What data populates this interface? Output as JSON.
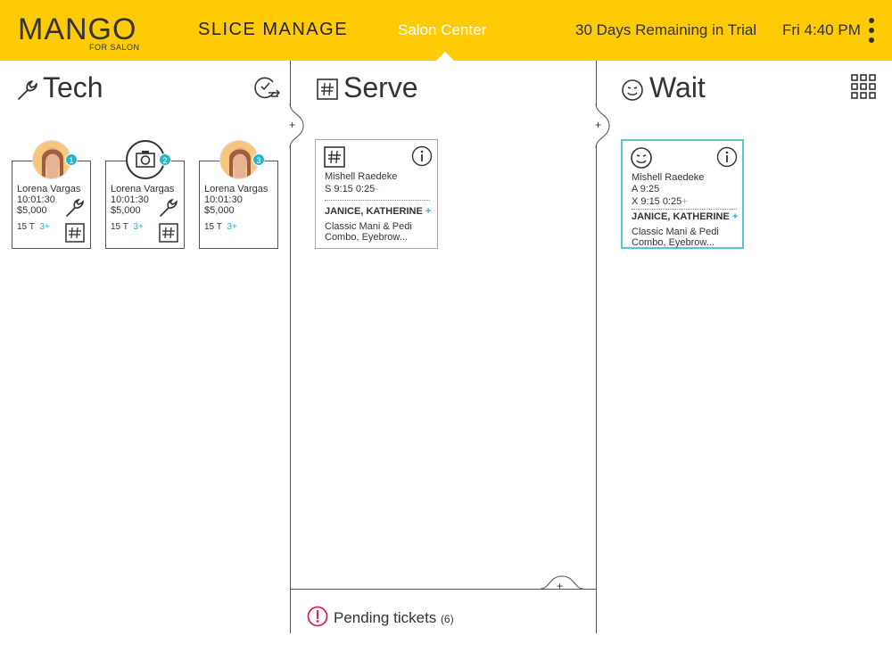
{
  "header": {
    "logo_text": "MANGO",
    "logo_sub": "FOR SALON",
    "nav_slice": "SLICE MANAGE",
    "nav_salon": "Salon Center",
    "trial": "30 Days Remaining in Trial",
    "clock": "Fri 4:40 PM",
    "brand_color": "#FFCB05",
    "accent_color": "#27B5C8"
  },
  "tech": {
    "title": "Tech",
    "cards": [
      {
        "badge": "1",
        "name": "Lorena Vargas",
        "time": "10:01:30",
        "money": "$5,000",
        "count": "15 T",
        "plus": "3+"
      },
      {
        "badge": "2",
        "name": "Lorena Vargas",
        "time": "10:01:30",
        "money": "$5,000",
        "count": "15 T",
        "plus": "3+"
      },
      {
        "badge": "3",
        "name": "Lorena Vargas",
        "time": "10:01:30",
        "money": "$5,000",
        "count": "15 T",
        "plus": "3+"
      }
    ]
  },
  "serve": {
    "title": "Serve",
    "plus": "+",
    "ticket": {
      "name": "Mishell Raedeke",
      "time_prefix": "S 9:15  0:25",
      "time_suffix": "-",
      "client": "JANICE, KATHERINE",
      "client_plus": "+",
      "service": "Classic Mani & Pedi Combo, Eyebrow..."
    }
  },
  "wait": {
    "title": "Wait",
    "plus": "+",
    "ticket": {
      "name": "Mishell Raedeke",
      "appt": "A 9:25",
      "time_prefix": "X 9:15  0:25",
      "time_suffix": "+",
      "client": "JANICE, KATHERINE",
      "client_plus": "+",
      "service": "Classic Mani & Pedi Combo, Eyebrow..."
    }
  },
  "pending": {
    "label": "Pending tickets",
    "count": "(6)",
    "plus": "+"
  }
}
